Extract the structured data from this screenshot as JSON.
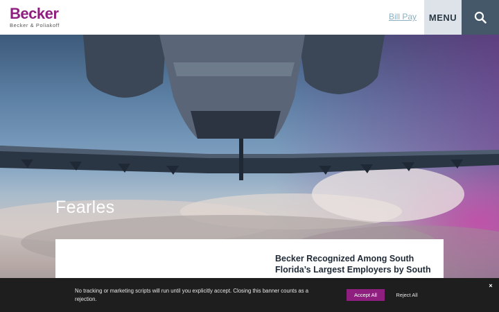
{
  "header": {
    "logo_main": "Becker",
    "logo_sub": "Becker & Poliakoff",
    "bill_pay": "Bill Pay",
    "menu": "MENU"
  },
  "hero": {
    "title": "Fearles"
  },
  "news": {
    "headline": "Becker Recognized Among South Florida’s Largest Employers by South"
  },
  "cookie_banner": {
    "text": "No tracking or marketing scripts will run until you explicitly accept. Closing this banner counts as a rejection.",
    "accept": "Accept All",
    "reject": "Reject All",
    "close": "×"
  },
  "colors": {
    "brand": "#8e1f7e",
    "menu_bg": "#dde3e8",
    "search_bg": "#44586a",
    "banner_bg": "#1e1e1e"
  },
  "icons": {
    "search": "search-icon",
    "close": "close-icon"
  }
}
